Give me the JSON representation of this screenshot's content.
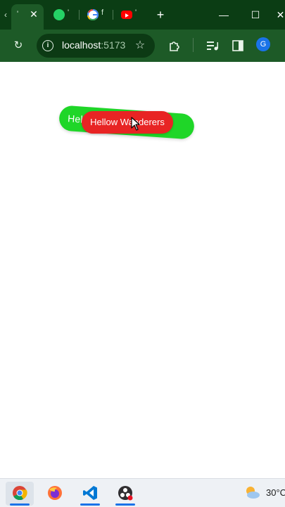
{
  "browser": {
    "tabs": [
      {
        "label": "‹"
      },
      {
        "label": "'"
      },
      {
        "label": "'"
      },
      {
        "label": "f"
      },
      {
        "label": "'"
      }
    ],
    "url_host": "localhost",
    "url_port": ":5173",
    "profile_initial": "G"
  },
  "page": {
    "green_pill_text": "Hellow Wanderers",
    "red_pill_text": "Hellow Wanderers"
  },
  "taskbar": {
    "temperature": "30°C"
  },
  "colors": {
    "green": "#1fd628",
    "red": "#e82424",
    "chrome_dark": "#0b3d14",
    "chrome_toolbar": "#1d5a27"
  }
}
